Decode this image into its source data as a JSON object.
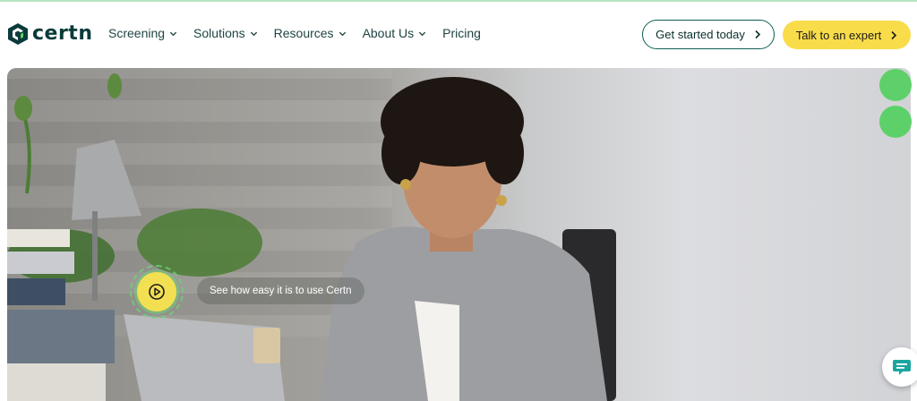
{
  "brand": {
    "name": "certn",
    "color_dark": "#0b3b3a",
    "color_green": "#5ed06a",
    "color_yellow": "#f9dc4a"
  },
  "nav": {
    "items": [
      {
        "label": "Screening",
        "has_dropdown": true
      },
      {
        "label": "Solutions",
        "has_dropdown": true
      },
      {
        "label": "Resources",
        "has_dropdown": true
      },
      {
        "label": "About Us",
        "has_dropdown": true
      },
      {
        "label": "Pricing",
        "has_dropdown": false
      }
    ]
  },
  "cta": {
    "primary_outline": "Get started today",
    "primary_yellow": "Talk to an expert"
  },
  "hero": {
    "caption": "See how easy it is to use Certn",
    "play_icon": "play-icon"
  },
  "widgets": {
    "chat_icon": "chat-icon"
  }
}
